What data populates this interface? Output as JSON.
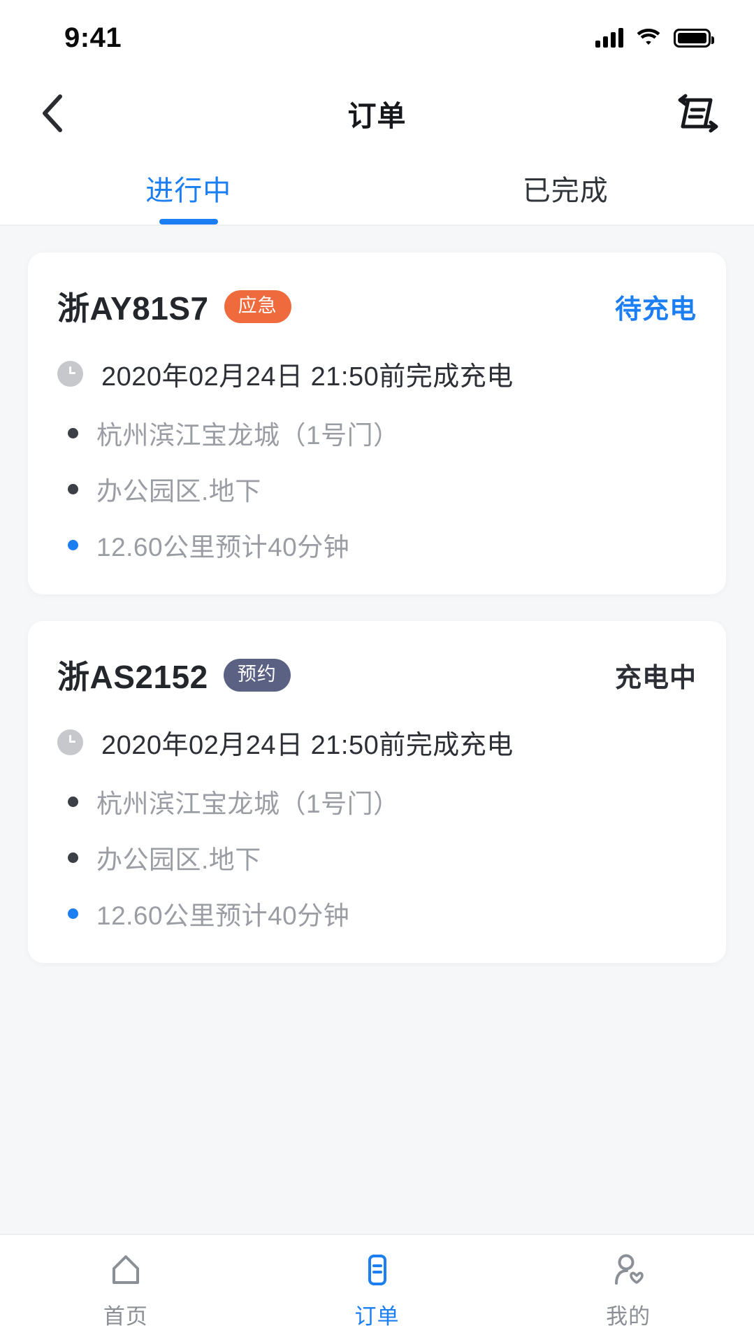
{
  "status_bar": {
    "time": "9:41",
    "signal_icon": "cellular-signal-icon",
    "wifi_icon": "wifi-icon",
    "battery_icon": "battery-full-icon"
  },
  "nav": {
    "back_icon": "back-chevron-icon",
    "title": "订单",
    "action_icon": "transaction-records-icon"
  },
  "tabs": [
    {
      "label": "进行中",
      "active": true
    },
    {
      "label": "已完成",
      "active": false
    }
  ],
  "orders": [
    {
      "plate": "浙AY81S7",
      "badge": "应急",
      "badge_color": "#ef6a3c",
      "status": "待充电",
      "status_color": "#1b7ef2",
      "time_icon": "clock-icon",
      "time": "2020年02月24日 21:50前完成充电",
      "details": [
        {
          "text": "杭州滨江宝龙城（1号门）",
          "dot_color": "#3c3f46"
        },
        {
          "text": "办公园区.地下",
          "dot_color": "#3c3f46"
        },
        {
          "text": "12.60公里预计40分钟",
          "dot_color": "#1b7ef2"
        }
      ]
    },
    {
      "plate": "浙AS2152",
      "badge": "预约",
      "badge_color": "#5b6183",
      "status": "充电中",
      "status_color": "#2c2f35",
      "time_icon": "clock-icon",
      "time": "2020年02月24日 21:50前完成充电",
      "details": [
        {
          "text": "杭州滨江宝龙城（1号门）",
          "dot_color": "#3c3f46"
        },
        {
          "text": "办公园区.地下",
          "dot_color": "#3c3f46"
        },
        {
          "text": "12.60公里预计40分钟",
          "dot_color": "#1b7ef2"
        }
      ]
    }
  ],
  "tabbar": [
    {
      "label": "首页",
      "icon": "home-icon",
      "active": false
    },
    {
      "label": "订单",
      "icon": "document-icon",
      "active": true
    },
    {
      "label": "我的",
      "icon": "profile-heart-icon",
      "active": false
    }
  ],
  "colors": {
    "accent": "#1b7ef2",
    "page_bg": "#f6f7f9",
    "card_bg": "#ffffff",
    "muted_text": "#9a9da3"
  }
}
